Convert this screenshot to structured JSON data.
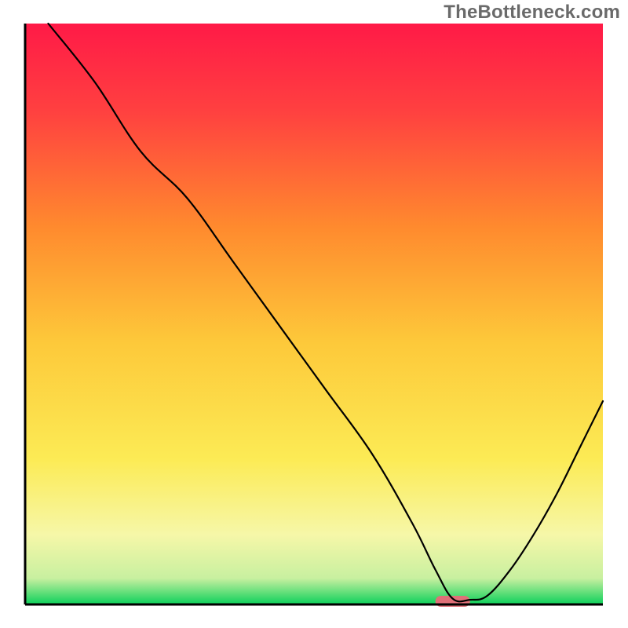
{
  "watermark": "TheBottleneck.com",
  "chart_data": {
    "type": "line",
    "title": "",
    "xlabel": "",
    "ylabel": "",
    "xlim": [
      0,
      100
    ],
    "ylim": [
      0,
      100
    ],
    "gradient_background": {
      "top_color": "#ff1a47",
      "upper_mid_color": "#ff7a3a",
      "mid_color": "#fdd23a",
      "lower_mid_color": "#fbf56a",
      "bottom_color": "#0cd05a"
    },
    "marker": {
      "x": 74,
      "y": 0,
      "color": "#e07078",
      "width_pct": 6
    },
    "series": [
      {
        "name": "curve",
        "color": "#000000",
        "x": [
          4,
          12,
          20,
          28,
          36,
          44,
          52,
          60,
          67,
          71,
          74,
          77,
          80,
          84,
          88,
          92,
          96,
          100
        ],
        "y": [
          100,
          90,
          78,
          70,
          59,
          48,
          37,
          26,
          14,
          6,
          1,
          0.8,
          1.5,
          6,
          12,
          19,
          27,
          35
        ]
      }
    ]
  }
}
